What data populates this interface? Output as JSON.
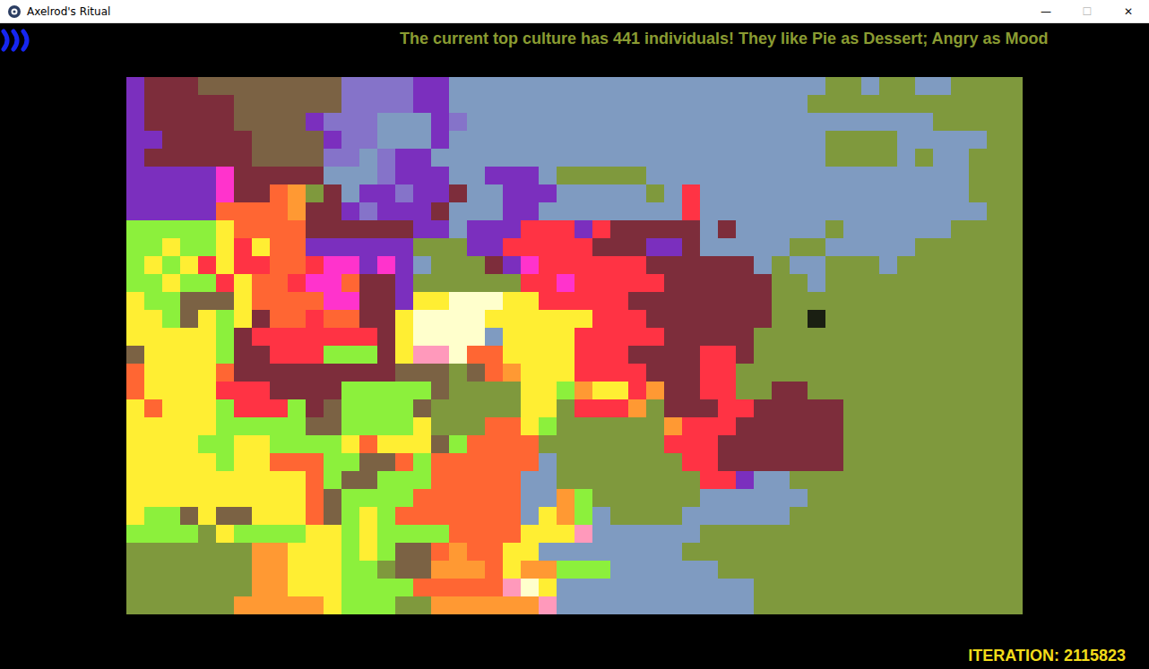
{
  "window": {
    "title": "Axelrod's Ritual",
    "controls": [
      {
        "label": "—",
        "disabled": false
      },
      {
        "label": "☐",
        "disabled": true
      },
      {
        "label": "✕",
        "disabled": false
      }
    ]
  },
  "ticker": "The current top culture has 441 individuals! They like Pie as Dessert; Angry as Mood",
  "iteration": "ITERATION: 2115823",
  "map": {
    "columns": 50,
    "legend": {
      "A": "#7b2fbe",
      "B": "#7d2d3b",
      "C": "#7b6244",
      "D": "#8573c9",
      "E": "#7f9bc1",
      "F": "#7f993d",
      "G": "#ff3344",
      "H": "#ff6633",
      "I": "#ff9933",
      "J": "#ffee33",
      "K": "#8cf03c",
      "L": "#ff33cc",
      "N": "#ffffcc",
      "O": "#1a1f12",
      "P": "#ff99bb"
    },
    "rows": [
      "A1B3C8D4A2E21F2E1F2E2F4",
      "A1B5C6D4A2E20F12",
      "A1B5C4A1D3E3A1D1E26F5",
      "A2B5C4A1D2E3A1E21F4E5F2",
      "A1B6C4D2E1D1A2E22F4E1F1E2F3",
      "A5L1B5E3D1A3E2A3E1F5E18F3",
      "A5L1B2H1I1F1B1E1A2D1A2B1E2A3E5F1E1G1E15F3",
      "A5H4I1B2A1D1A3B1E3A2E8G1E16F2",
      "K5J1H4B6A2E1A3G3A1G1B5E1B1E5F1E6F4",
      "K2J1K2J1G1J1H2A6F3A2G5B3A2B1E5F2E5F6",
      "K1J1K1J1G1J1G2H2G1L2A1L1A1E1F3B1A1L1G6B6E1F1E2F3E1F7",
      "K2J1K2G1J1H2G1L2H1B2A1F6G2L1G5B6F2E1F11",
      "J1K2C3J1H4L2B2A1J2N3J2G5B8F14",
      "J2K1C1J1K1J1B1H2G1H2B2J1N4J6G3B7F2O1F11",
      "J5K1B1G7B1J1N4E1J4G5B5F15",
      "C1J4K1B2G3K3B1J1P2N1H2J4G3B4G2B1F15",
      "H1J4H1B9C3F1C1H1I1J3G4B3G2F16",
      "H1J4G3B4K5C1F4J2K1I1J2G1I1B2G2F2B2F12",
      "J1H1J3K1G3K1B1C1K4C1F5J2F1G3I1F1B3G2B5F10",
      "J5K5C2K4J1F3H2J1K1F6I1G3B6F10",
      "J4K2J2K4J1H1J3C1K1H4F7G3B7F10",
      "J5K1J2H3K2C2H1K1H6E1F7G2B7F10",
      "J10H1K1C2K3H5E2F8G2A1E2F13",
      "J10H1C1K4H6E2I1K1F6E6F12",
      "J1K2C1J1C2J3H1C1K1J1K1H7E1J1I1K1E1F4E6F13",
      "K4F1J1K4J2K1J1K4H4J3P1E6F18",
      "F7I2J3K1J1K1C2H1I1H2J2E8F19",
      "F7I2J3K2F1C2I3H1J1I2K3E6F17",
      "F7I2J3K4H5P1N1J1E11F15",
      "F6I5J1K3F2I6P1E11F15"
    ]
  }
}
